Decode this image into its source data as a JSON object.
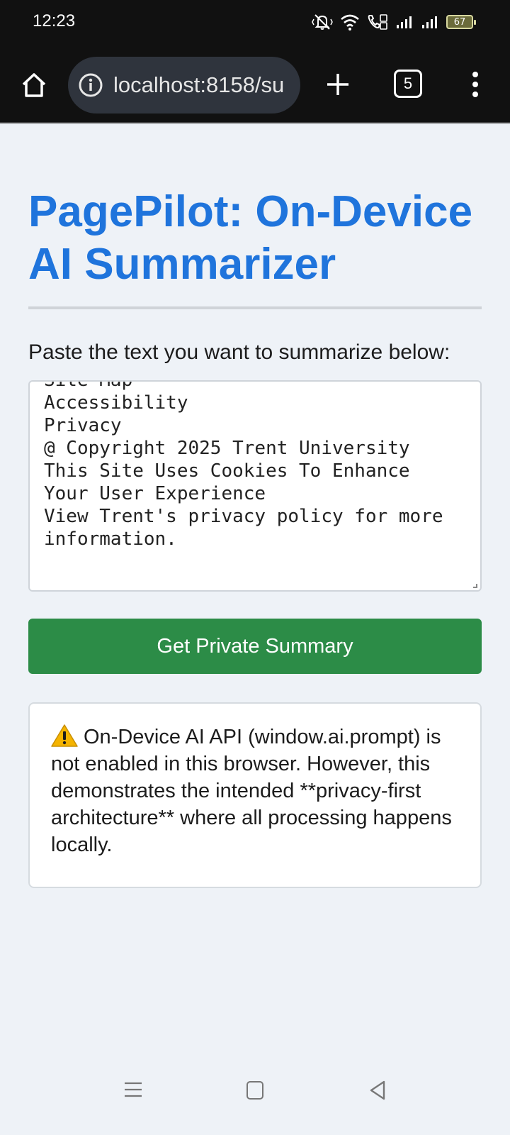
{
  "status_bar": {
    "time": "12:23",
    "battery": "67",
    "icons": [
      "mute-icon",
      "wifi-icon",
      "volte-icon",
      "signal-icon",
      "signal-icon",
      "battery-icon"
    ]
  },
  "browser": {
    "url": "localhost:8158/su",
    "tab_count": "5",
    "icons": [
      "home-icon",
      "site-info-icon",
      "new-tab-icon",
      "tabs-icon",
      "more-menu-icon"
    ]
  },
  "page": {
    "title": "PagePilot: On-Device AI Summarizer",
    "prompt_label": "Paste the text you want to summarize below:",
    "textarea_lines": [
      "Site Map",
      "Accessibility",
      "Privacy",
      "@ Copyright 2025 Trent University",
      "This Site Uses Cookies To Enhance",
      "Your User Experience",
      "View Trent's privacy policy for more",
      "information."
    ],
    "button_label": "Get Private Summary",
    "notice_text": "On-Device AI API (window.ai.prompt) is not enabled in this browser. However, this demonstrates the intended **privacy-first architecture** where all processing happens locally."
  },
  "colors": {
    "title": "#1f74dc",
    "button": "#2c8c47",
    "background": "#eef2f7",
    "chrome": "#111111"
  }
}
